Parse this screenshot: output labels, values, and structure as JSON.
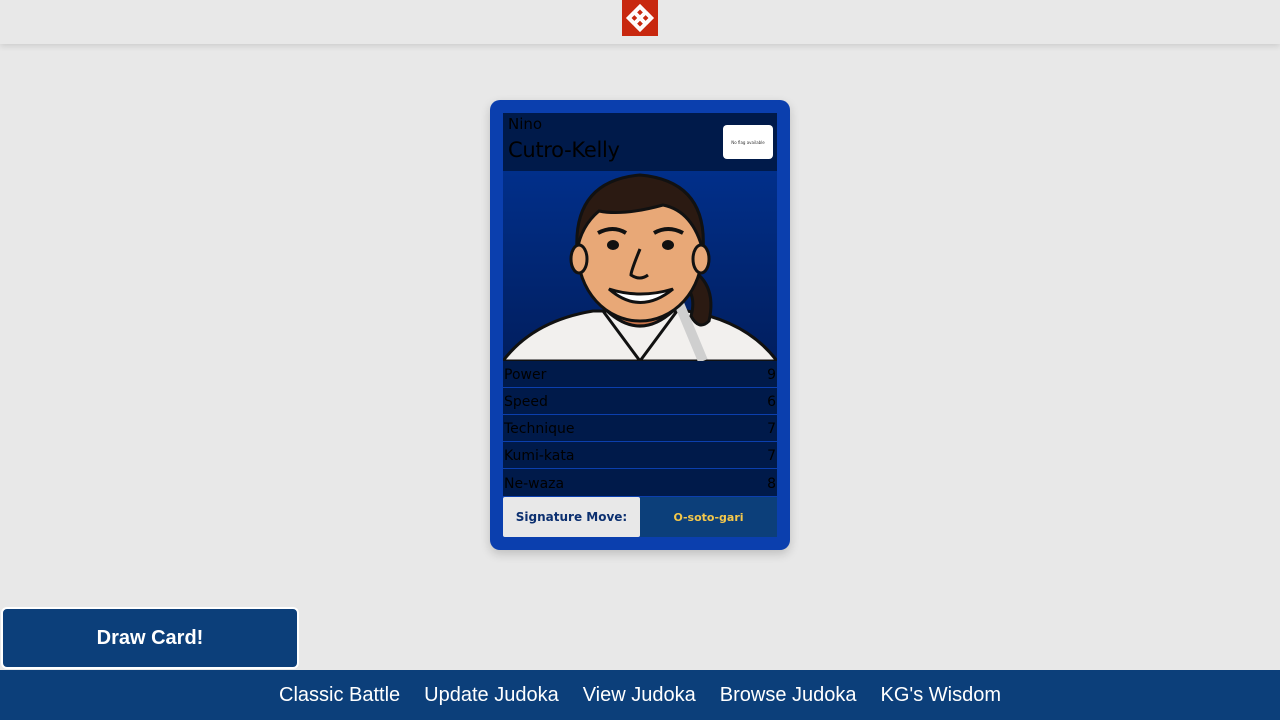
{
  "header": {
    "logo_icon": "red-knot-logo-icon"
  },
  "card": {
    "first_name": "Nino",
    "last_name": "Cutro-Kelly",
    "flag_text": "No flag available",
    "portrait_icon": "judoka-portrait",
    "stats": [
      {
        "label": "Power",
        "value": "9"
      },
      {
        "label": "Speed",
        "value": "6"
      },
      {
        "label": "Technique",
        "value": "7"
      },
      {
        "label": "Kumi-kata",
        "value": "7"
      },
      {
        "label": "Ne-waza",
        "value": "8"
      }
    ],
    "signature_label": "Signature Move:",
    "signature_value": "O-soto-gari"
  },
  "actions": {
    "draw_label": "Draw Card!"
  },
  "nav": {
    "items": [
      {
        "label": "Classic Battle"
      },
      {
        "label": "Update Judoka"
      },
      {
        "label": "View Judoka"
      },
      {
        "label": "Browse Judoka"
      },
      {
        "label": "KG's Wisdom"
      }
    ]
  },
  "colors": {
    "card_blue": "#0b3fae",
    "nav_blue": "#0c3f7a",
    "logo_red": "#c8280f",
    "signature_gold": "#f5c84b"
  }
}
